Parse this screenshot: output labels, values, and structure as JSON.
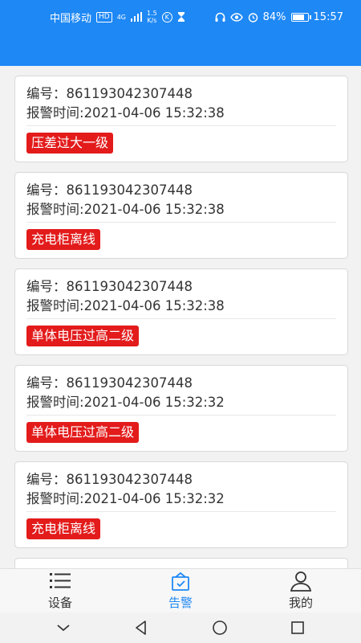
{
  "status_bar": {
    "carrier": "中国移动",
    "hd": "HD",
    "net": "4G",
    "speed_value": "1.5",
    "speed_unit": "K/s",
    "k_badge": "K",
    "battery_text": "84%",
    "battery_level": 0.84,
    "time": "15:57"
  },
  "alarms": [
    {
      "id_label": "编号：",
      "id": "861193042307448",
      "time_label": "报警时间:",
      "time": "2021-04-06 15:32:38",
      "tag": "压差过大一级"
    },
    {
      "id_label": "编号：",
      "id": "861193042307448",
      "time_label": "报警时间:",
      "time": "2021-04-06 15:32:38",
      "tag": "充电柜离线"
    },
    {
      "id_label": "编号：",
      "id": "861193042307448",
      "time_label": "报警时间:",
      "time": "2021-04-06 15:32:38",
      "tag": "单体电压过高二级"
    },
    {
      "id_label": "编号：",
      "id": "861193042307448",
      "time_label": "报警时间:",
      "time": "2021-04-06 15:32:32",
      "tag": "单体电压过高二级"
    },
    {
      "id_label": "编号：",
      "id": "861193042307448",
      "time_label": "报警时间:",
      "time": "2021-04-06 15:32:32",
      "tag": "充电柜离线"
    }
  ],
  "tabs": [
    {
      "label": "设备",
      "icon": "list-icon"
    },
    {
      "label": "告警",
      "icon": "alarm-icon"
    },
    {
      "label": "我的",
      "icon": "user-icon"
    }
  ],
  "colors": {
    "primary": "#1e88f5",
    "alarm_tag": "#e31b1b"
  }
}
